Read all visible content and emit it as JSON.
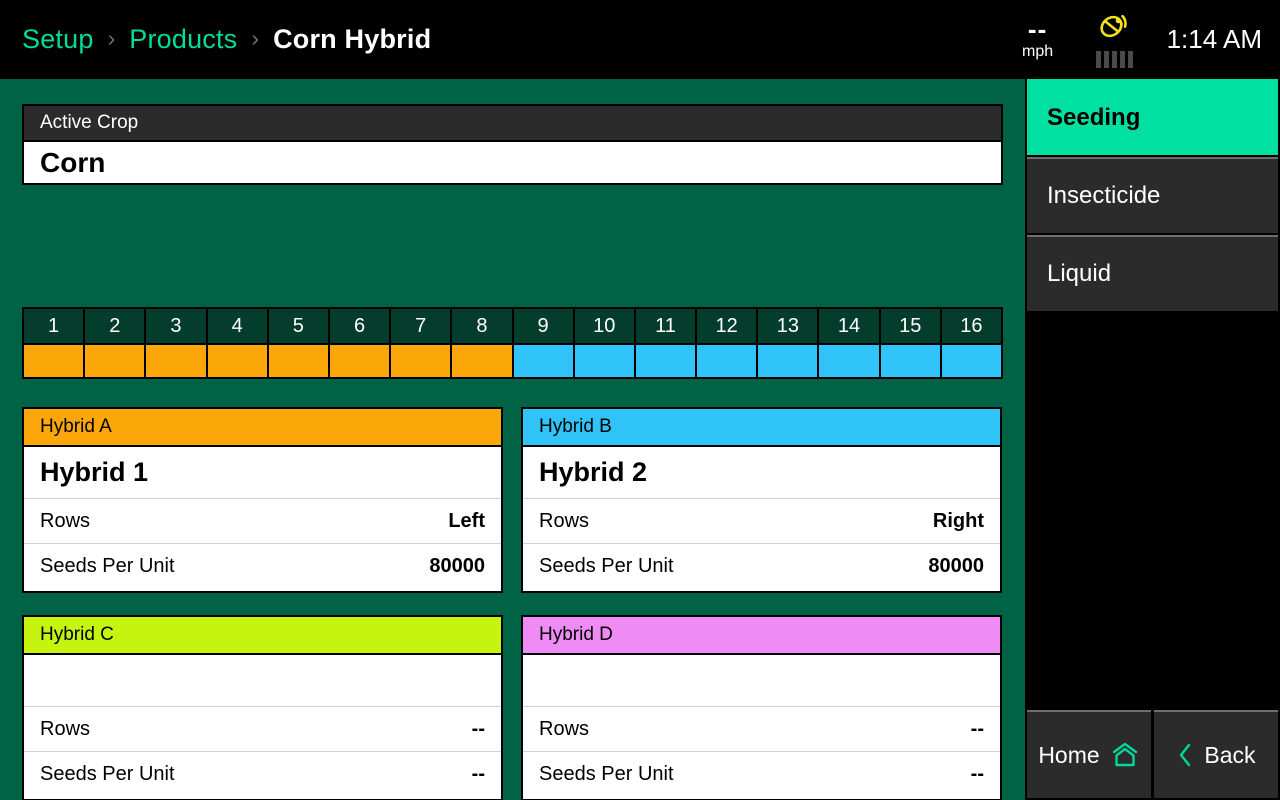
{
  "header": {
    "breadcrumb": [
      {
        "label": "Setup",
        "current": false
      },
      {
        "label": "Products",
        "current": false
      },
      {
        "label": "Corn Hybrid",
        "current": true
      }
    ],
    "separator": "›",
    "status": {
      "speed_value": "--",
      "speed_unit": "mph",
      "gps_icon": "satellite-dish-icon",
      "gps_bar_count": 5,
      "time": "1:14 AM"
    }
  },
  "main": {
    "active_crop": {
      "title": "Active Crop",
      "value": "Corn"
    },
    "row_strip": {
      "rows": [
        {
          "number": "1",
          "color": "#FBA70A"
        },
        {
          "number": "2",
          "color": "#FBA70A"
        },
        {
          "number": "3",
          "color": "#FBA70A"
        },
        {
          "number": "4",
          "color": "#FBA70A"
        },
        {
          "number": "5",
          "color": "#FBA70A"
        },
        {
          "number": "6",
          "color": "#FBA70A"
        },
        {
          "number": "7",
          "color": "#FBA70A"
        },
        {
          "number": "8",
          "color": "#FBA70A"
        },
        {
          "number": "9",
          "color": "#2FC3F7"
        },
        {
          "number": "10",
          "color": "#2FC3F7"
        },
        {
          "number": "11",
          "color": "#2FC3F7"
        },
        {
          "number": "12",
          "color": "#2FC3F7"
        },
        {
          "number": "13",
          "color": "#2FC3F7"
        },
        {
          "number": "14",
          "color": "#2FC3F7"
        },
        {
          "number": "15",
          "color": "#2FC3F7"
        },
        {
          "number": "16",
          "color": "#2FC3F7"
        }
      ]
    },
    "hybrids": [
      {
        "header": "Hybrid A",
        "header_color": "#FBA70A",
        "name": "Hybrid 1",
        "rows_label": "Rows",
        "rows_value": "Left",
        "seeds_label": "Seeds Per Unit",
        "seeds_value": "80000"
      },
      {
        "header": "Hybrid B",
        "header_color": "#2FC3F7",
        "name": "Hybrid 2",
        "rows_label": "Rows",
        "rows_value": "Right",
        "seeds_label": "Seeds Per Unit",
        "seeds_value": "80000"
      },
      {
        "header": "Hybrid C",
        "header_color": "#C6F410",
        "name": "",
        "rows_label": "Rows",
        "rows_value": "--",
        "seeds_label": "Seeds Per Unit",
        "seeds_value": "--"
      },
      {
        "header": "Hybrid D",
        "header_color": "#EE8BF5",
        "name": "",
        "rows_label": "Rows",
        "rows_value": "--",
        "seeds_label": "Seeds Per Unit",
        "seeds_value": "--"
      }
    ]
  },
  "sidebar": {
    "items": [
      {
        "label": "Seeding",
        "active": true
      },
      {
        "label": "Insecticide",
        "active": false
      },
      {
        "label": "Liquid",
        "active": false
      }
    ],
    "bottom": {
      "home_label": "Home",
      "home_icon": "home-icon",
      "back_label": "Back",
      "back_icon": "chevron-left-icon"
    }
  },
  "colors": {
    "background_green": "#016345",
    "row_header_green": "#053d2c",
    "accent_teal": "#00e0a0",
    "breadcrumb_link": "#00dd96",
    "panel_dark": "#2b2b2b",
    "gps_yellow": "#F2E41A"
  }
}
